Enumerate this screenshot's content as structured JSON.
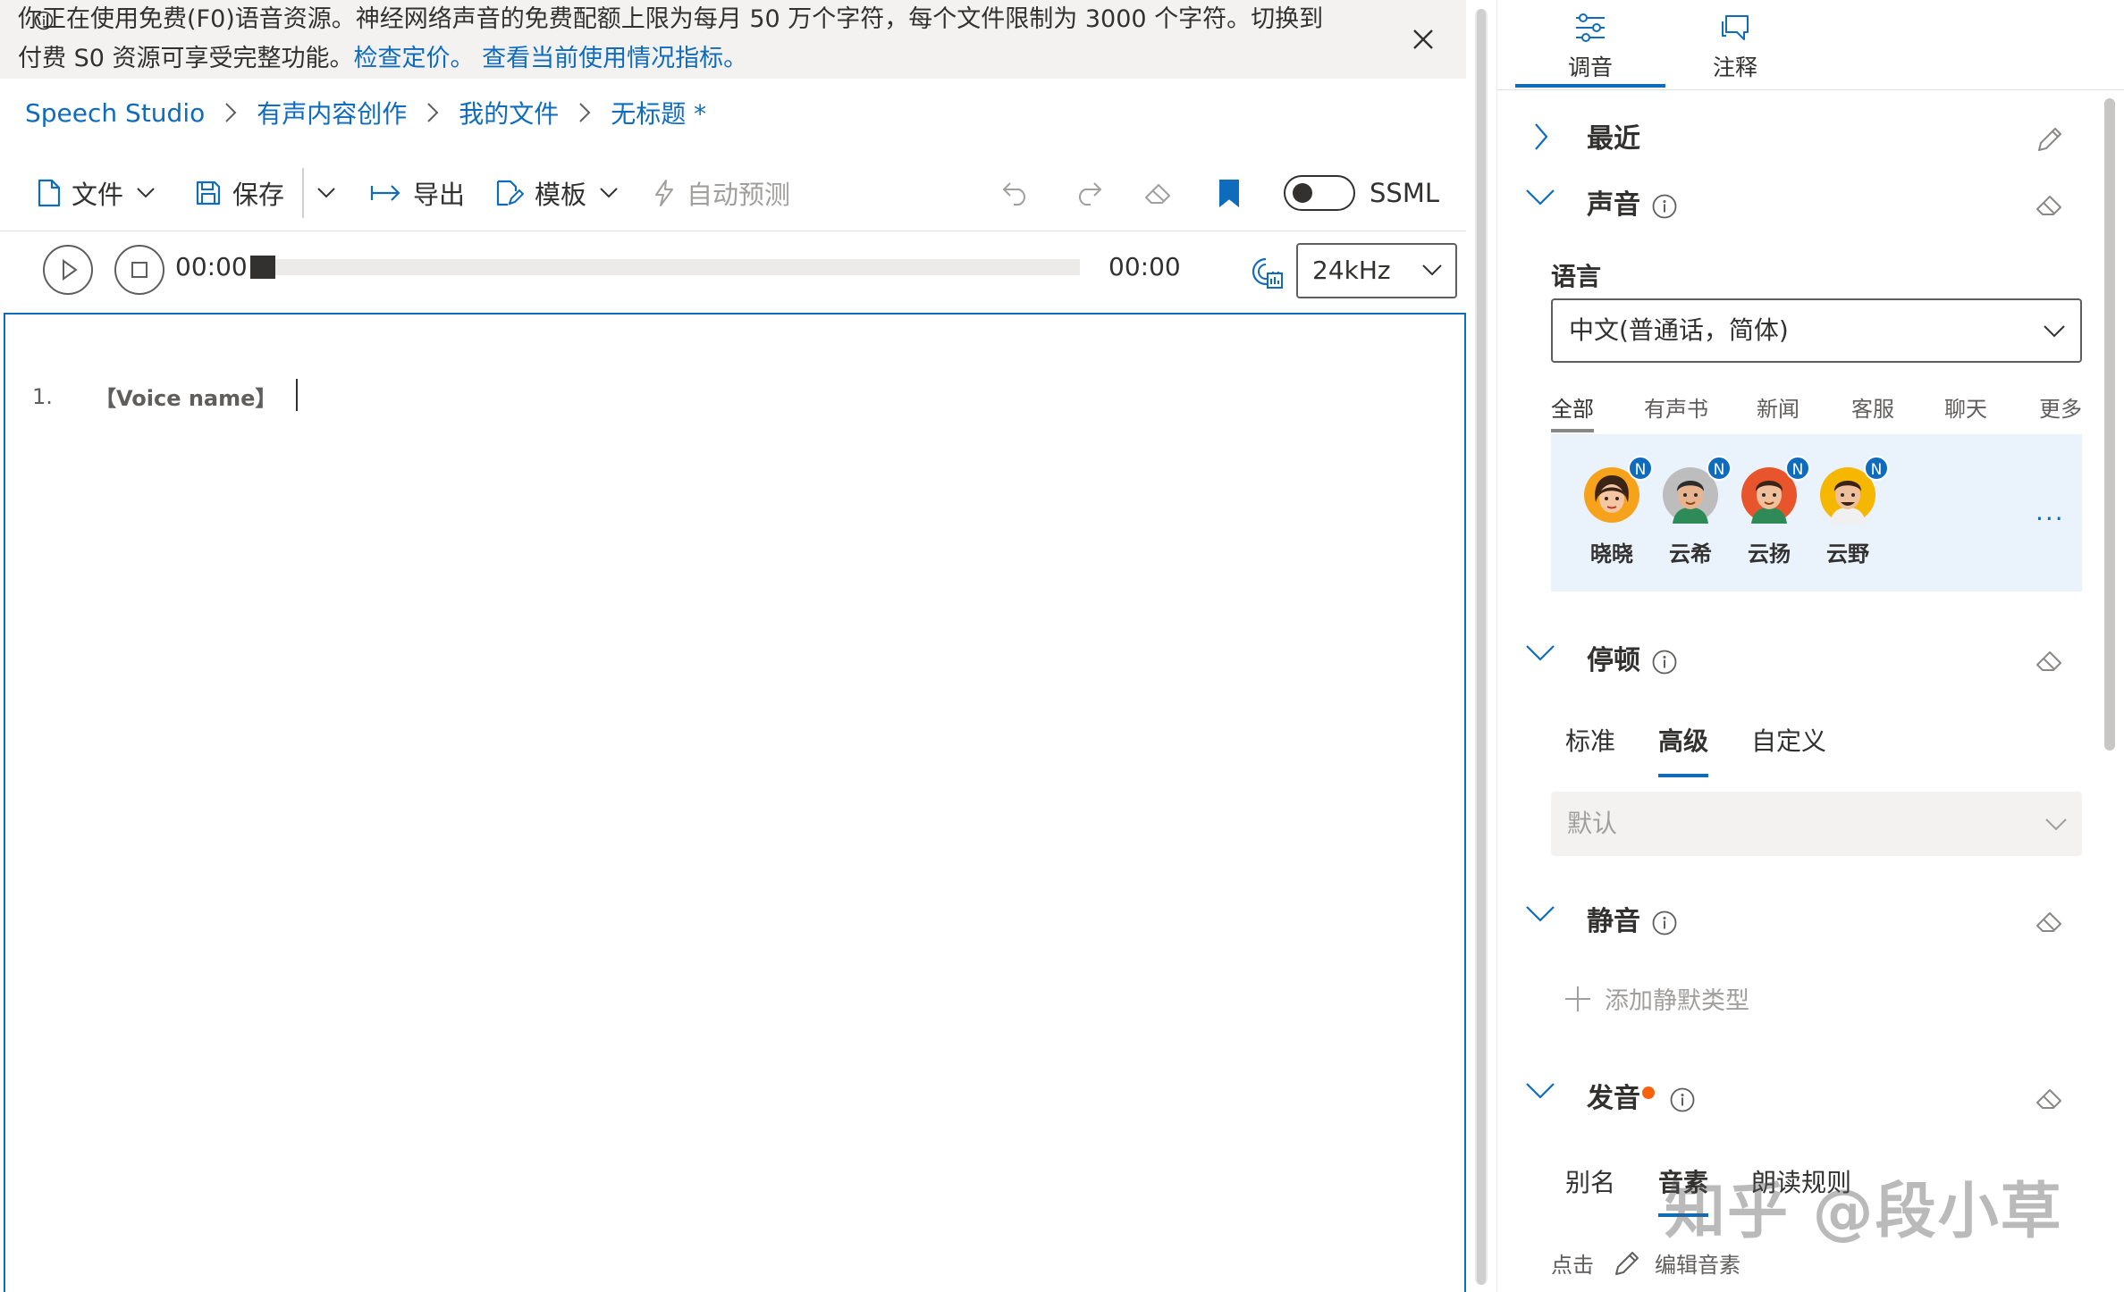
{
  "banner": {
    "text_line1": "你正在使用免费(F0)语音资源。神经网络声音的免费配额上限为每月 50 万个字符，每个文件限制为 3000 个字符。切换到",
    "text_line2": "付费 S0 资源可享受完整功能。",
    "link_pricing": "检查定价。",
    "link_usage": "查看当前使用情况指标。"
  },
  "breadcrumb": {
    "items": [
      "Speech Studio",
      "有声内容创作",
      "我的文件",
      "无标题 *"
    ]
  },
  "toolbar": {
    "file": "文件",
    "save": "保存",
    "export": "导出",
    "template": "模板",
    "autopredict": "自动预测",
    "ssml": "SSML",
    "ssml_enabled": false
  },
  "playback": {
    "current_time": "00:00",
    "total_time": "00:00",
    "progress": 0,
    "sample_rate": "24kHz"
  },
  "editor": {
    "line_number": "1.",
    "voice_tag": "【Voice name】"
  },
  "panel": {
    "tabs": [
      "调音",
      "注释"
    ],
    "active_tab": "调音",
    "sections": {
      "recent": "最近",
      "voice": "声音",
      "pause": "停顿",
      "silence": "静音",
      "pronunciation": "发音"
    },
    "language_label": "语言",
    "language_value": "中文(普通话，简体)",
    "categories": [
      "全部",
      "有声书",
      "新闻",
      "客服",
      "聊天",
      "更多"
    ],
    "active_category": "全部",
    "voices": [
      {
        "name": "晓晓",
        "badge": "N"
      },
      {
        "name": "云希",
        "badge": "N"
      },
      {
        "name": "云扬",
        "badge": "N"
      },
      {
        "name": "云野",
        "badge": "N"
      }
    ],
    "voice_more": "...",
    "pause_tabs": [
      "标准",
      "高级",
      "自定义"
    ],
    "pause_active": "高级",
    "pause_select": "默认",
    "add_silence": "添加静默类型",
    "pron_tabs": [
      "别名",
      "音素",
      "朗读规则"
    ],
    "pron_active": "音素",
    "click_label": "点击",
    "edit_phoneme": "编辑音素"
  },
  "watermark": "知乎 @段小草",
  "colors": {
    "accent": "#0f6cbd",
    "banner_bg": "#f3f2f1",
    "voice_area_bg": "#eaf3fb",
    "notify_dot": "#f7630c"
  }
}
